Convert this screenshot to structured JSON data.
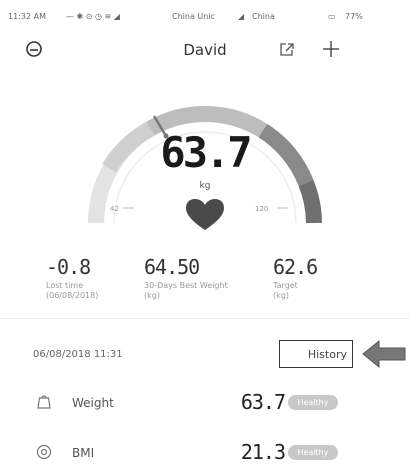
{
  "status_bar": {
    "time": "11:32 AM",
    "carrier1": "China Unic",
    "carrier2": "China",
    "battery": "77%"
  },
  "header": {
    "title": "David",
    "left_icon": "menu-icon",
    "share_icon": "share-icon",
    "add_icon": "plus-icon"
  },
  "gauge": {
    "value": "63.7",
    "unit": "kg",
    "min_label": "42",
    "max_label": "120",
    "heart_icon": "heart-icon",
    "colors": {
      "track": "#e3e3e3",
      "light_segment": "#cfcfcf",
      "mid_segment": "#bdbdbd",
      "dark_segment": "#6f6f6f",
      "heart": "#4a4a4a"
    }
  },
  "stats": [
    {
      "value": "-0.8",
      "label_line1": "Lost time",
      "label_line2": "(06/08/2018)"
    },
    {
      "value": "64.50",
      "label_line1": "30-Days Best Weight",
      "label_line2": "(kg)"
    },
    {
      "value": "62.6",
      "label_line1": "Target",
      "label_line2": "(kg)"
    }
  ],
  "record": {
    "timestamp": "06/08/2018 11:31",
    "history_label": "History"
  },
  "metrics": [
    {
      "label": "Weight",
      "value": "63.7",
      "badge": "Healthy",
      "icon": "scale-icon"
    },
    {
      "label": "BMI",
      "value": "21.3",
      "badge": "Healthy",
      "icon": "bmi-icon"
    }
  ]
}
